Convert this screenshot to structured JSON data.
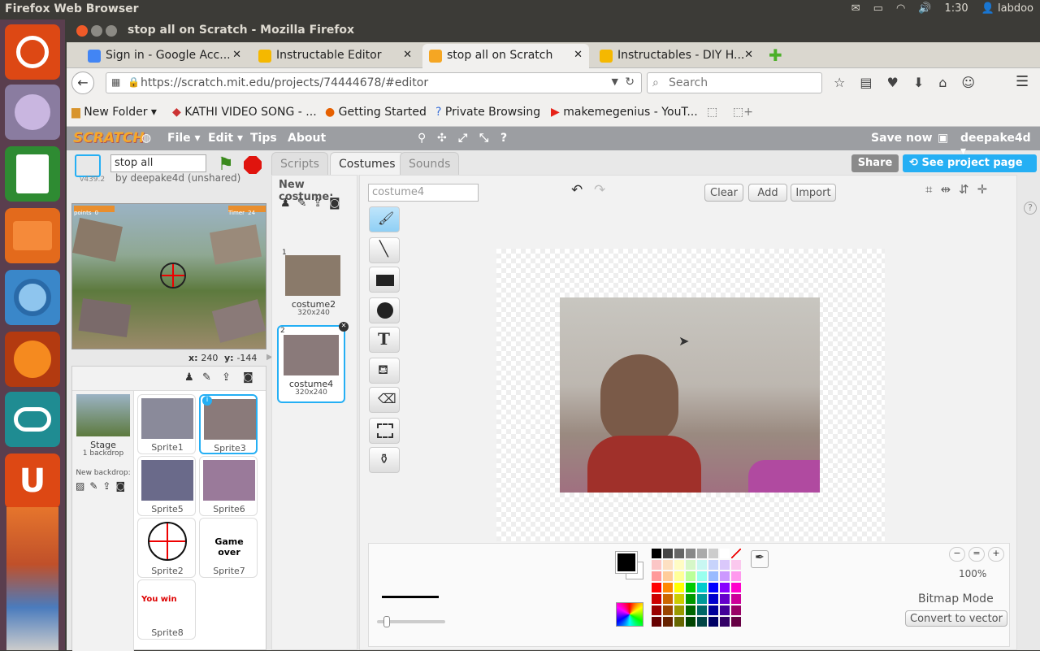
{
  "os": {
    "title": "Firefox Web Browser",
    "time": "1:30",
    "user": "labdoo"
  },
  "window": {
    "title": "stop all on Scratch - Mozilla Firefox"
  },
  "tabs": [
    {
      "label": "Sign in - Google Acc...",
      "color": "#4285f4"
    },
    {
      "label": "Instructable Editor",
      "color": "#f5b800"
    },
    {
      "label": "stop all on Scratch",
      "color": "#f5a623"
    },
    {
      "label": "Instructables - DIY H...",
      "color": "#f5b800"
    }
  ],
  "nav": {
    "url": "https://scratch.mit.edu/projects/74444678/#editor",
    "search_placeholder": "Search"
  },
  "bookmarks": [
    {
      "label": "New Folder ▾"
    },
    {
      "label": "KATHI VIDEO SONG - ..."
    },
    {
      "label": "Getting Started"
    },
    {
      "label": "Private Browsing"
    },
    {
      "label": "makemegenius - YouT..."
    }
  ],
  "scratch": {
    "logo": "SCRATCH",
    "menu": {
      "file": "File ▾",
      "edit": "Edit ▾",
      "tips": "Tips",
      "about": "About",
      "save": "Save now",
      "user": "deepake4d ▾"
    },
    "share": "Share",
    "see_project": "See project page",
    "project_title": "stop all",
    "byline": "by deepake4d (unshared)",
    "version": "v439.2",
    "coords": {
      "x_label": "x:",
      "x": "240",
      "y_label": "y:",
      "y": "-144"
    },
    "hud": {
      "points": "points",
      "points_val": "0",
      "timer": "Timer",
      "timer_val": "24"
    },
    "editor_tabs": {
      "scripts": "Scripts",
      "costumes": "Costumes",
      "sounds": "Sounds"
    },
    "new_costume": "New costume:",
    "costumes": [
      {
        "num": "1",
        "name": "costume2",
        "size": "320x240"
      },
      {
        "num": "2",
        "name": "costume4",
        "size": "320x240"
      }
    ],
    "costume_name_value": "costume4",
    "paint_buttons": {
      "clear": "Clear",
      "add": "Add",
      "import": "Import"
    },
    "stage": {
      "label": "Stage",
      "sub": "1 backdrop",
      "new_backdrop": "New backdrop:"
    },
    "sprites": [
      {
        "name": "Sprite1"
      },
      {
        "name": "Sprite3"
      },
      {
        "name": "Sprite5"
      },
      {
        "name": "Sprite6"
      },
      {
        "name": "Sprite2"
      },
      {
        "name": "Sprite7",
        "text": "Game over"
      },
      {
        "name": "Sprite8",
        "text": "You win"
      }
    ],
    "zoom": "100%",
    "mode": "Bitmap Mode",
    "convert": "Convert to vector",
    "colors": {
      "accent": "#25aff4",
      "menubar": "#9c9ea2",
      "stop": "#e0140e",
      "flag": "#3a8a1c"
    }
  }
}
